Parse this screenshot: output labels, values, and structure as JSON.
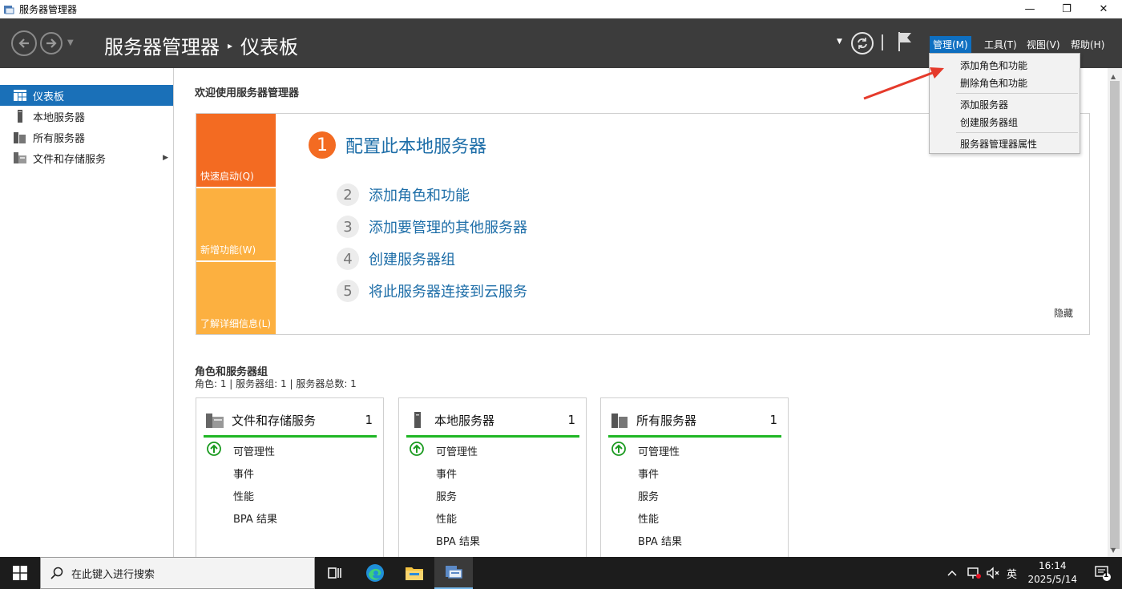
{
  "window": {
    "title": "服务器管理器",
    "minimize": "—",
    "maximize": "❐",
    "close": "✕"
  },
  "header": {
    "breadcrumb_root": "服务器管理器",
    "breadcrumb_sep": "▸",
    "breadcrumb_current": "仪表板",
    "menus": [
      "管理(M)",
      "工具(T)",
      "视图(V)",
      "帮助(H)"
    ]
  },
  "manage_menu": {
    "items": [
      "添加角色和功能",
      "删除角色和功能",
      "添加服务器",
      "创建服务器组",
      "服务器管理器属性"
    ]
  },
  "sidebar": {
    "items": [
      {
        "label": "仪表板",
        "icon": "dashboard-icon"
      },
      {
        "label": "本地服务器",
        "icon": "server-icon"
      },
      {
        "label": "所有服务器",
        "icon": "servers-icon"
      },
      {
        "label": "文件和存储服务",
        "icon": "storage-icon"
      }
    ]
  },
  "welcome": {
    "title": "欢迎使用服务器管理器",
    "tiles": [
      "快速启动(Q)",
      "新增功能(W)",
      "了解详细信息(L)"
    ],
    "steps": [
      {
        "num": "1",
        "label": "配置此本地服务器"
      },
      {
        "num": "2",
        "label": "添加角色和功能"
      },
      {
        "num": "3",
        "label": "添加要管理的其他服务器"
      },
      {
        "num": "4",
        "label": "创建服务器组"
      },
      {
        "num": "5",
        "label": "将此服务器连接到云服务"
      }
    ],
    "hide": "隐藏"
  },
  "roles": {
    "title": "角色和服务器组",
    "subtitle": "角色: 1 | 服务器组: 1 | 服务器总数: 1",
    "cards": [
      {
        "title": "文件和存储服务",
        "count": "1",
        "rows": [
          "可管理性",
          "事件",
          "性能",
          "BPA 结果"
        ]
      },
      {
        "title": "本地服务器",
        "count": "1",
        "rows": [
          "可管理性",
          "事件",
          "服务",
          "性能",
          "BPA 结果"
        ]
      },
      {
        "title": "所有服务器",
        "count": "1",
        "rows": [
          "可管理性",
          "事件",
          "服务",
          "性能",
          "BPA 结果"
        ]
      }
    ]
  },
  "taskbar": {
    "search_placeholder": "在此键入进行搜索",
    "ime": "英",
    "time": "16:14",
    "date": "2025/5/14",
    "notification_count": "1"
  },
  "colors": {
    "accent": "#1a70b8",
    "orange": "#f36b22",
    "amber": "#fcb040",
    "green": "#1fb624",
    "header": "#3c3c3c"
  }
}
